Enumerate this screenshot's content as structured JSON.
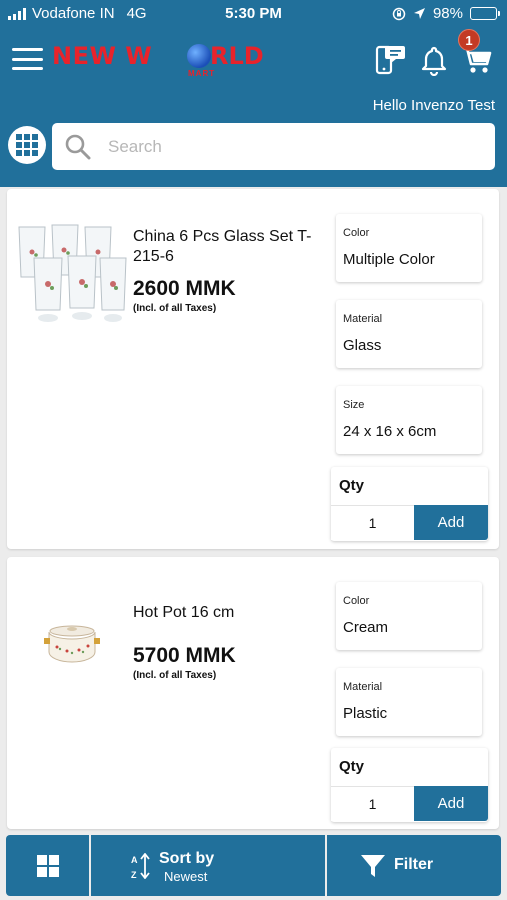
{
  "status_bar": {
    "carrier": "Vodafone IN",
    "network": "4G",
    "time": "5:30 PM",
    "battery": "98%"
  },
  "header": {
    "logo_text_1": "NEW W",
    "logo_text_2": "RLD",
    "logo_text_3": "MART",
    "cart_count": "1",
    "greeting": "Hello Invenzo Test"
  },
  "search": {
    "placeholder": "Search"
  },
  "products": [
    {
      "name": "China 6 Pcs Glass Set T-215-6",
      "price": "2600 MMK",
      "tax_note": "(Incl. of all Taxes)",
      "attributes": [
        {
          "label": "Color",
          "value": "Multiple Color"
        },
        {
          "label": "Material",
          "value": "Glass"
        },
        {
          "label": "Size",
          "value": "24 x 16 x 6cm"
        }
      ],
      "qty_label": "Qty",
      "qty_value": "1",
      "add_label": "Add"
    },
    {
      "name": "Hot Pot 16 cm",
      "price": "5700 MMK",
      "tax_note": "(Incl. of all Taxes)",
      "attributes": [
        {
          "label": "Color",
          "value": "Cream"
        },
        {
          "label": "Material",
          "value": "Plastic"
        }
      ],
      "qty_label": "Qty",
      "qty_value": "1",
      "add_label": "Add"
    }
  ],
  "bottom_bar": {
    "sort_label": "Sort by",
    "sort_value": "Newest",
    "filter_label": "Filter"
  },
  "colors": {
    "brand_blue": "#21709b",
    "logo_red": "#e8232b",
    "badge_red": "#c33a24"
  },
  "icons": [
    "menu-icon",
    "chat-icon",
    "bell-icon",
    "cart-icon",
    "grid-icon",
    "search-icon",
    "sort-icon",
    "filter-icon"
  ]
}
